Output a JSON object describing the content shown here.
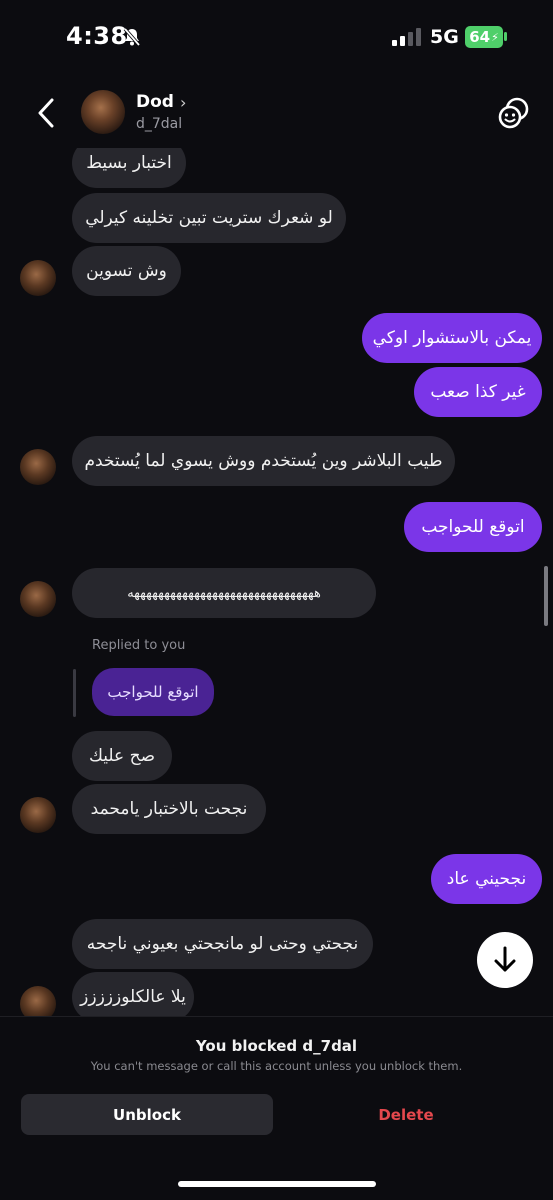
{
  "status_bar": {
    "time": "4:38",
    "network": "5G",
    "battery": "64",
    "icons": [
      "bell-slash-icon",
      "signal-icon",
      "charging-icon"
    ]
  },
  "header": {
    "name": "Dod",
    "username": "d_7dal",
    "icons": [
      "back-chevron-icon",
      "chevron-right-icon",
      "chat-theme-icon"
    ]
  },
  "messages": [
    {
      "direction": "received",
      "text": "اختبار بسيط"
    },
    {
      "direction": "received",
      "text": "لو شعرك ستريت تبين تخلينه كيرلي"
    },
    {
      "direction": "received",
      "text": "وش تسوين"
    },
    {
      "direction": "sent",
      "text": "يمكن بالاستشوار اوكي"
    },
    {
      "direction": "sent",
      "text": "غير كذا صعب"
    },
    {
      "direction": "received",
      "text": "طيب البلاشر وين يُستخدم ووش يسوي لما يُستخدم"
    },
    {
      "direction": "sent",
      "text": "اتوقع للحواجب"
    },
    {
      "direction": "received",
      "text": "هههههههههههههههههههههههههههههههه"
    },
    {
      "direction": "received",
      "reply_label": "Replied to you",
      "quoted_text": "اتوقع للحواجب"
    },
    {
      "direction": "received",
      "text": "صح عليك"
    },
    {
      "direction": "received",
      "text": "نجحت بالاختبار يامحمد"
    },
    {
      "direction": "sent",
      "text": "نجحيني عاد"
    },
    {
      "direction": "received",
      "text": "نجحتي وحتى لو مانجحتي بعيوني ناجحه"
    },
    {
      "direction": "received",
      "text": "يلا عالكلوززززز"
    }
  ],
  "footer": {
    "blocked_title": "You blocked d_7dal",
    "blocked_subtitle": "You can't message or call this account unless you unblock them.",
    "unblock_label": "Unblock",
    "delete_label": "Delete"
  },
  "colors": {
    "background": "#0c0c10",
    "received_bubble": "#27272d",
    "sent_bubble": "#7b36e8",
    "quoted_bubble": "#4a2394",
    "delete_red": "#e5484d",
    "battery_green": "#4fcf6a"
  }
}
